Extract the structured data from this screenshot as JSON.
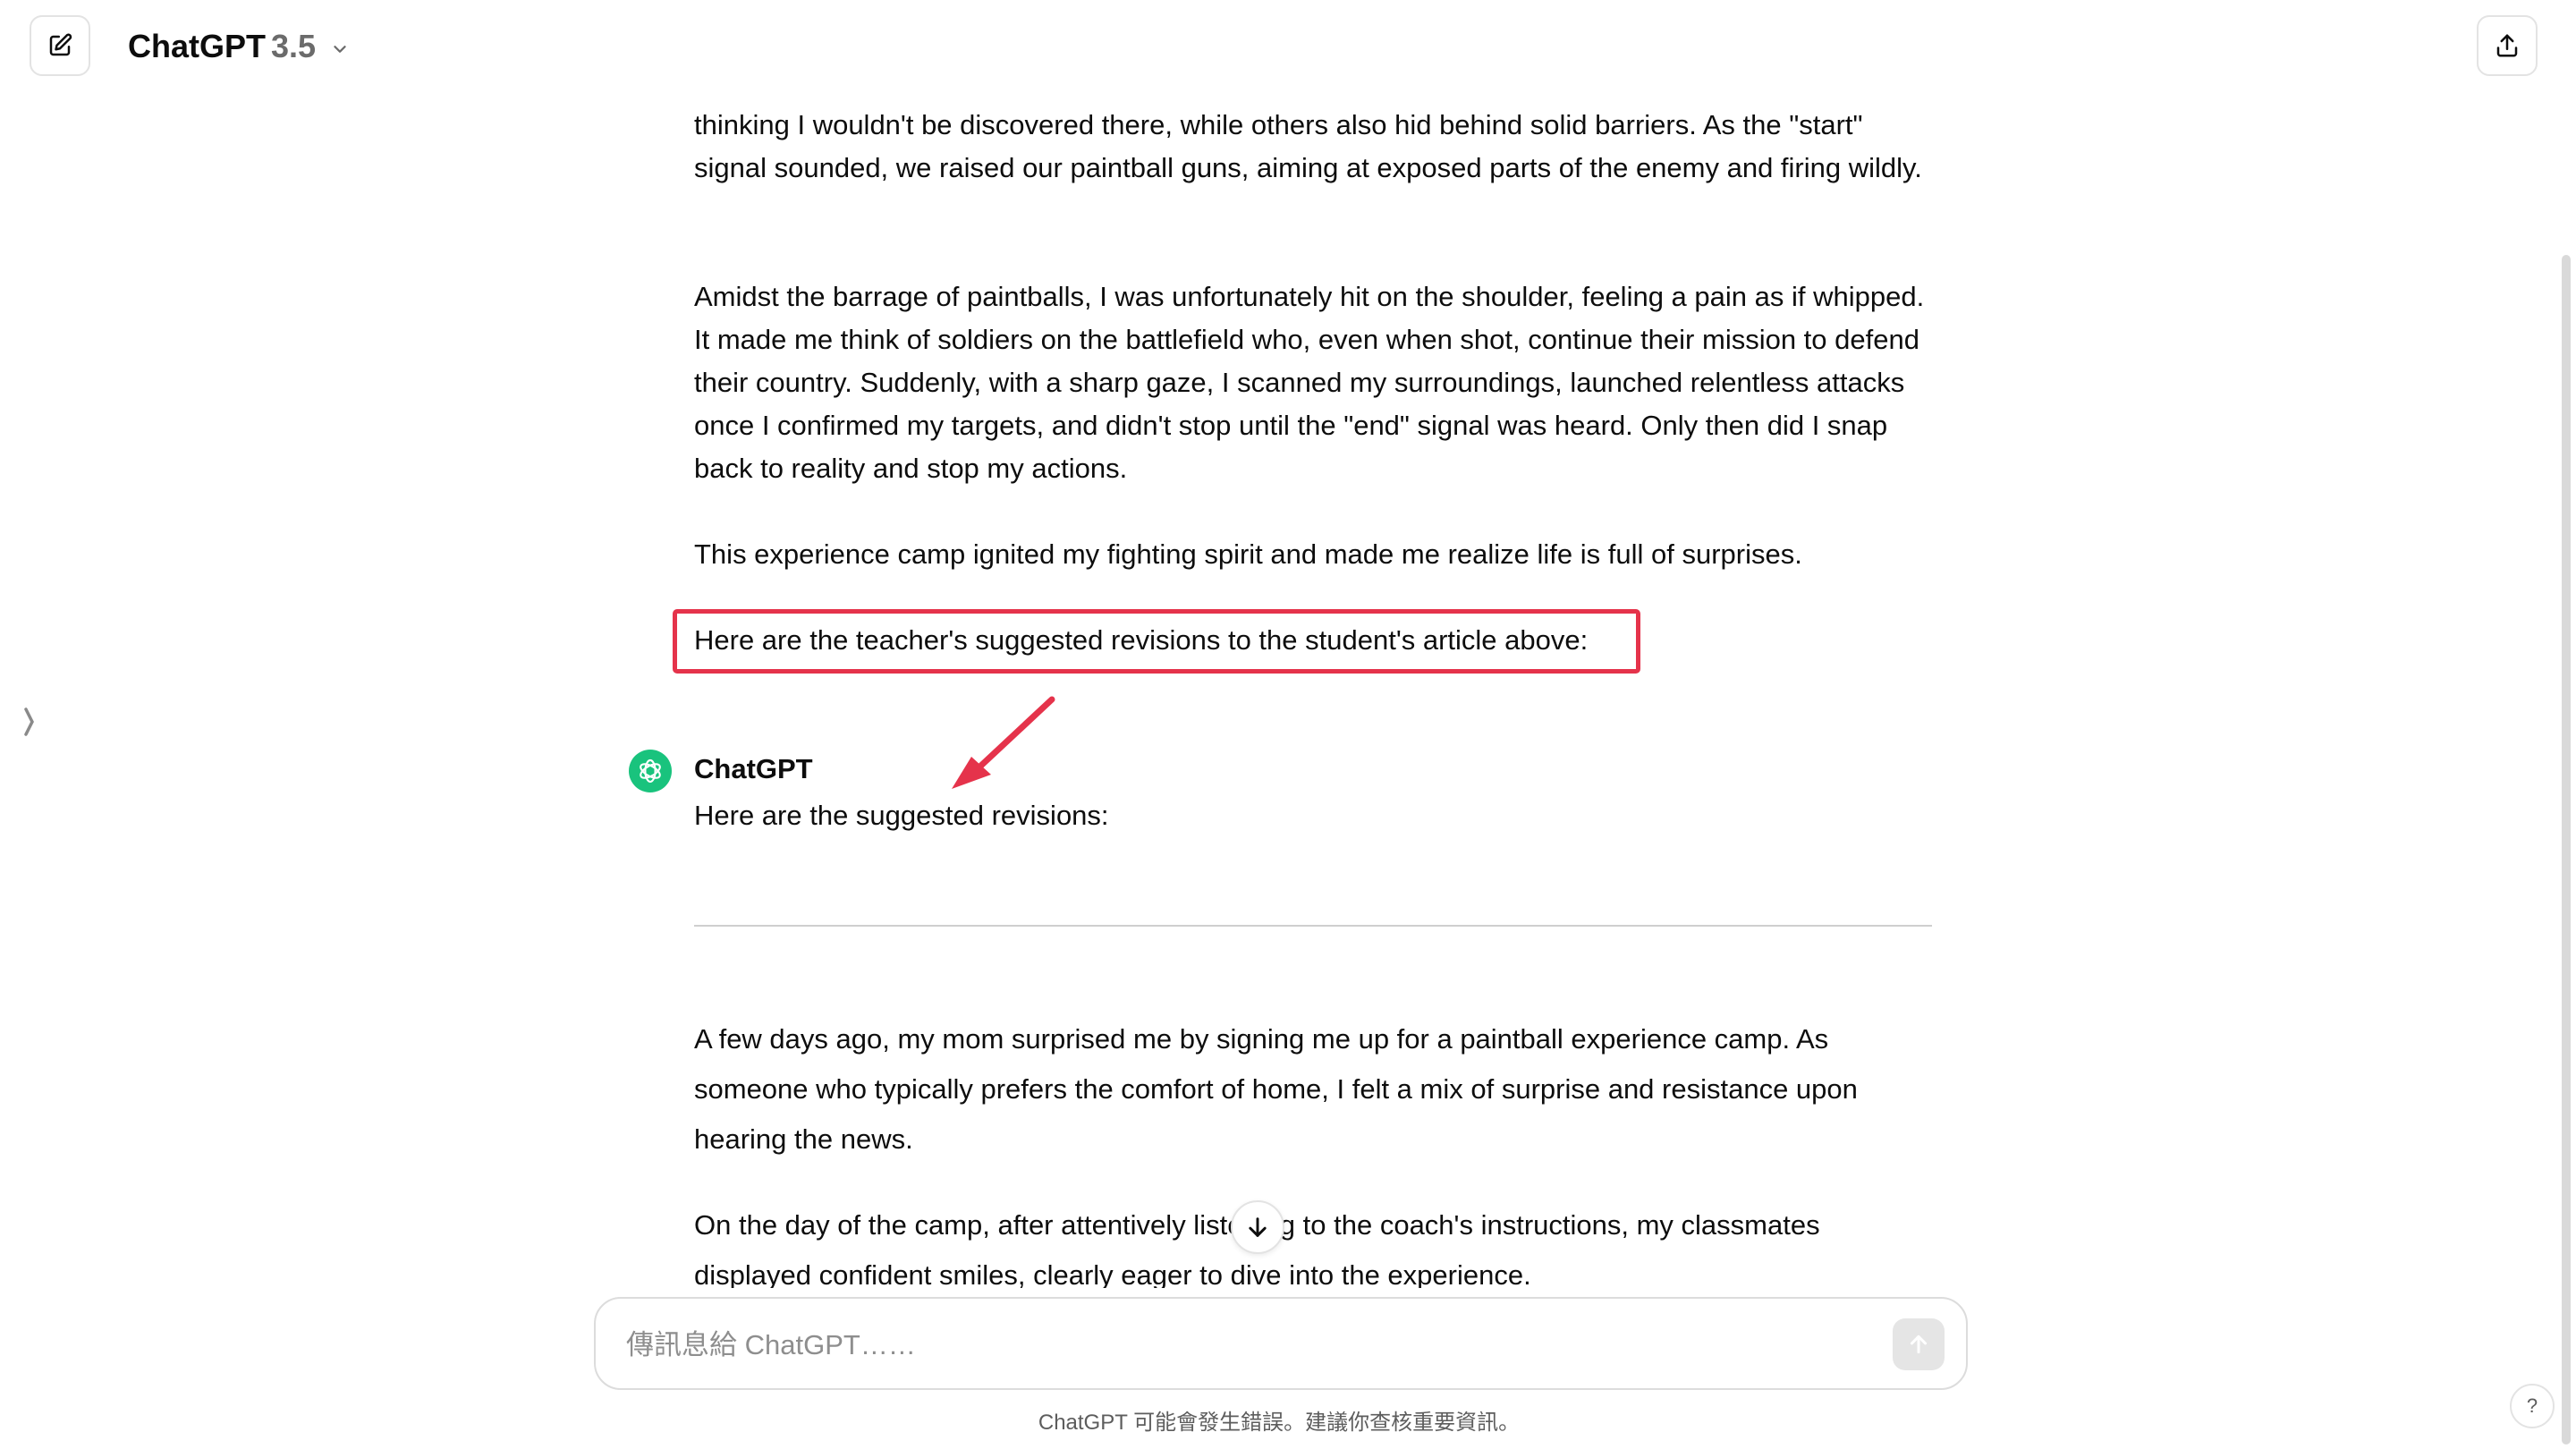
{
  "header": {
    "model_name": "ChatGPT",
    "model_version": "3.5",
    "new_chat_icon": "compose-icon",
    "share_icon": "share-icon"
  },
  "conversation": {
    "user_paragraphs": [
      "thinking I wouldn't be discovered there, while others also hid behind solid barriers. As the \"start\" signal sounded, we raised our paintball guns, aiming at exposed parts of the enemy and firing wildly.",
      "Amidst the barrage of paintballs, I was unfortunately hit on the shoulder, feeling a pain as if whipped. It made me think of soldiers on the battlefield who, even when shot, continue their mission to defend their country. Suddenly, with a sharp gaze, I scanned my surroundings, launched relentless attacks once I confirmed my targets, and didn't stop until the \"end\" signal was heard. Only then did I snap back to reality and stop my actions.",
      "This experience camp ignited my fighting spirit and made me realize life is full of surprises."
    ],
    "highlighted_prompt": "Here are the teacher's suggested revisions to the student's article above:",
    "assistant_name": "ChatGPT",
    "assistant_intro": "Here are the suggested revisions:",
    "revised_paragraphs": [
      "A few days ago, my mom surprised me by signing me up for a paintball experience camp. As someone who typically prefers the comfort of home, I felt a mix of surprise and resistance upon hearing the news.",
      "On the day of the camp, after attentively listening to the coach's instructions, my classmates displayed confident smiles, clearly eager to dive into the experience."
    ]
  },
  "composer": {
    "placeholder": "傳訊息給 ChatGPT……",
    "send_icon": "arrow-up-icon"
  },
  "footer": {
    "disclaimer": "ChatGPT 可能會發生錯誤。建議你查核重要資訊。",
    "help_label": "?"
  },
  "colors": {
    "highlight_border": "#e5334b",
    "annotation_arrow": "#e5334b",
    "assistant_avatar": "#19c37d"
  }
}
